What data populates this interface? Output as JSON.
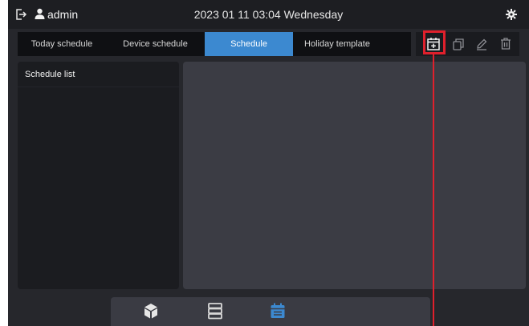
{
  "header": {
    "user": "admin",
    "datetime": "2023 01 11 03:04 Wednesday",
    "icons": [
      "logout-icon",
      "user-icon",
      "gear-icon"
    ]
  },
  "tabs": [
    {
      "label": "Today schedule",
      "active": false
    },
    {
      "label": "Device schedule",
      "active": false
    },
    {
      "label": "Schedule",
      "active": true
    },
    {
      "label": "Holiday template",
      "active": false
    }
  ],
  "toolbar": {
    "icons": [
      "add-schedule-icon",
      "copy-icon",
      "edit-icon",
      "delete-icon"
    ],
    "highlighted": "add-schedule-icon"
  },
  "left_panel": {
    "title": "Schedule list"
  },
  "bottom_nav": {
    "icons": [
      "device-cube-icon",
      "server-list-icon",
      "calendar-icon"
    ],
    "active": "calendar-icon"
  },
  "colors": {
    "accent": "#3c89d0",
    "highlight": "#e0202c",
    "background": "#26272c"
  }
}
